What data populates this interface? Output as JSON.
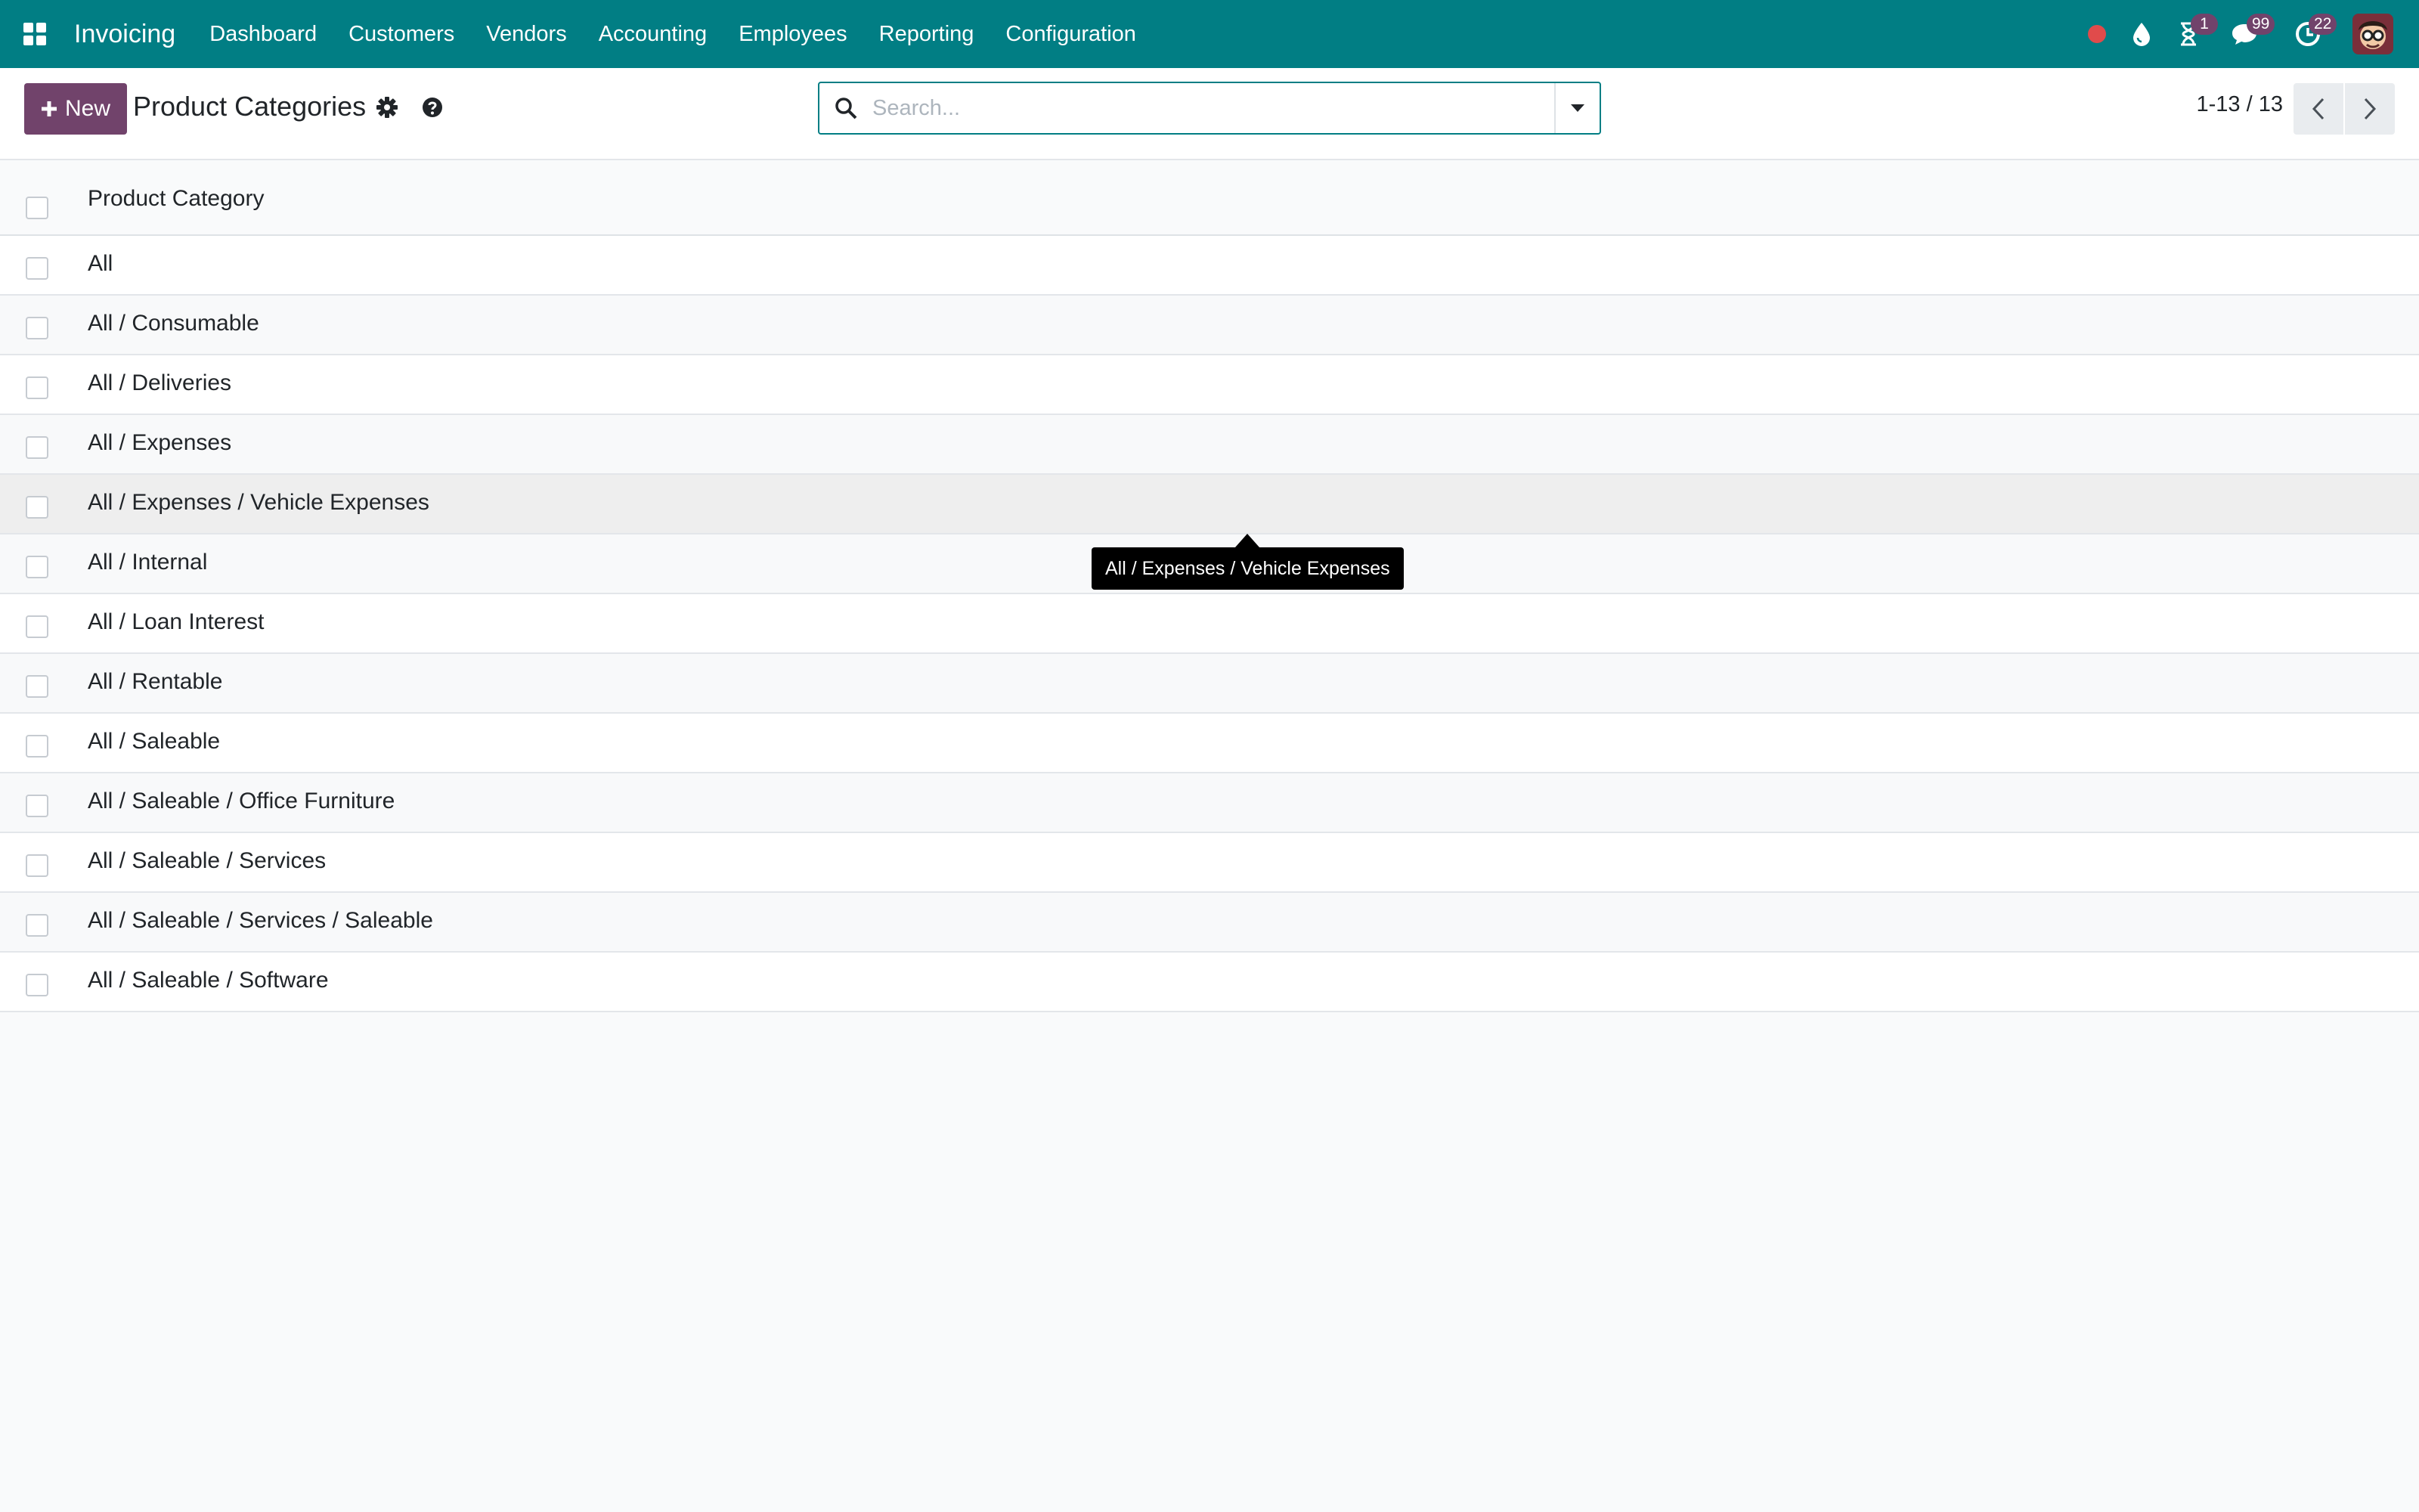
{
  "navbar": {
    "brand": "Invoicing",
    "menu": [
      {
        "label": "Dashboard"
      },
      {
        "label": "Customers"
      },
      {
        "label": "Vendors"
      },
      {
        "label": "Accounting"
      },
      {
        "label": "Employees"
      },
      {
        "label": "Reporting"
      },
      {
        "label": "Configuration"
      }
    ],
    "systray": {
      "recording_icon": "record-dot-icon",
      "drop_icon": "water-drop-icon",
      "activities_badge": "1",
      "messages_badge": "99",
      "clock_badge": "22"
    },
    "colors": {
      "bar": "#017e84",
      "badge": "#71436b",
      "record": "#e04b4b"
    }
  },
  "control_panel": {
    "new_button": "New",
    "title": "Product Categories",
    "search_placeholder": "Search...",
    "pager": "1-13 / 13"
  },
  "list": {
    "column_header": "Product Category",
    "rows": [
      "All",
      "All / Consumable",
      "All / Deliveries",
      "All / Expenses",
      "All / Expenses / Vehicle Expenses",
      "All / Internal",
      "All / Loan Interest",
      "All / Rentable",
      "All / Saleable",
      "All / Saleable / Office Furniture",
      "All / Saleable / Services",
      "All / Saleable / Services / Saleable",
      "All / Saleable / Software"
    ],
    "hovered_row_index": 4
  },
  "tooltip": {
    "text": "All / Expenses / Vehicle Expenses"
  }
}
